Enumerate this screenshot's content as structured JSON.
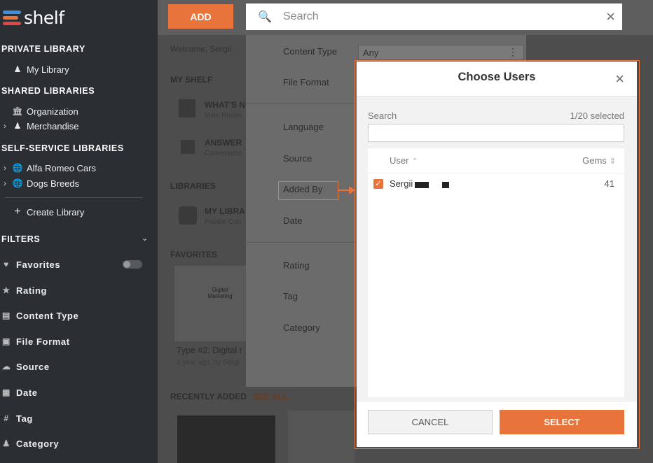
{
  "brand": {
    "name": "shelf"
  },
  "sidebar": {
    "private_header": "PRIVATE LIBRARY",
    "my_library": "My Library",
    "shared_header": "SHARED LIBRARIES",
    "organization": "Organization",
    "merchandise": "Merchandise",
    "selfservice_header": "SELF-SERVICE LIBRARIES",
    "alfa": "Alfa Romeo Cars",
    "dogs": "Dogs Breeds",
    "create": "Create Library",
    "filters_header": "FILTERS",
    "filters": [
      "Favorites",
      "Rating",
      "Content Type",
      "File Format",
      "Source",
      "Date",
      "Tag",
      "Category"
    ]
  },
  "topbar": {
    "add_label": "ADD",
    "search_placeholder": "Search"
  },
  "main": {
    "welcome": "Welcome, Sergii",
    "my_shelf": "MY SHELF",
    "whats_new": "WHAT'S N",
    "view_recent": "View Recen",
    "answer": "ANSWER",
    "conversation": "Conversatio",
    "libraries": "LIBRARIES",
    "my_libra": "MY LIBRA",
    "private_con": "Private Con",
    "favorites": "FAVORITES",
    "thumb_title": "Digital Marketing",
    "card_title": "Type #2: Digital r",
    "card_meta": "a year ago, by Sergi",
    "recently_added": "RECENTLY ADDED",
    "see_all": "SEE ALL"
  },
  "filter_panel": {
    "content_type_label": "Content Type",
    "content_type_value": "Any",
    "file_format": "File Format",
    "language": "Language",
    "source": "Source",
    "added_by": "Added By",
    "date": "Date",
    "rating": "Rating",
    "tag": "Tag",
    "category": "Category"
  },
  "modal": {
    "title": "Choose Users",
    "search_label": "Search",
    "selected_count": "1/20 selected",
    "col_user": "User",
    "col_gems": "Gems",
    "rows": [
      {
        "user": "Sergii",
        "gems": "41",
        "checked": true
      }
    ],
    "cancel_label": "CANCEL",
    "select_label": "SELECT"
  },
  "colors": {
    "accent": "#e8743b",
    "sidebar_bg": "#2b2f33"
  }
}
